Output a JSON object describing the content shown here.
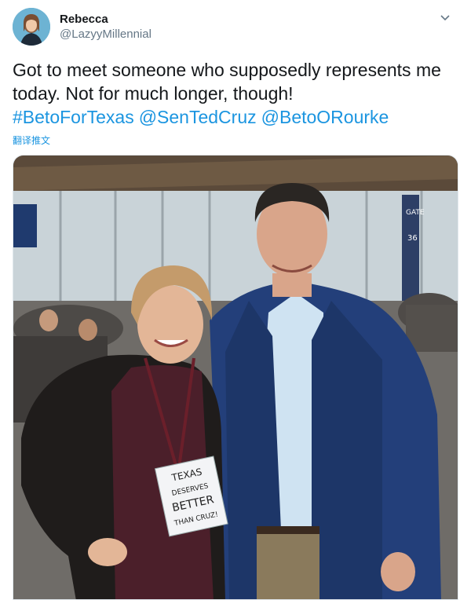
{
  "user": {
    "display_name": "Rebecca",
    "handle": "@LazyyMillennial",
    "avatar_icon": "profile-photo"
  },
  "tweet": {
    "text": "Got to meet someone who supposedly represents me today. Not for much longer, though!",
    "hashtags": [
      "#BetoForTexas",
      "@SenTedCruz",
      "@BetoORourke"
    ],
    "translate_label": "翻译推文"
  },
  "menu_icon": "chevron-down-icon",
  "photo": {
    "sign_lines": [
      "TEXAS",
      "DESERVES",
      "BETTER",
      "THAN CRUZ!"
    ],
    "gate_sign": [
      "GATE",
      "36"
    ]
  },
  "colors": {
    "link": "#1b95e0",
    "secondary_text": "#657786",
    "primary_text": "#14171a"
  }
}
